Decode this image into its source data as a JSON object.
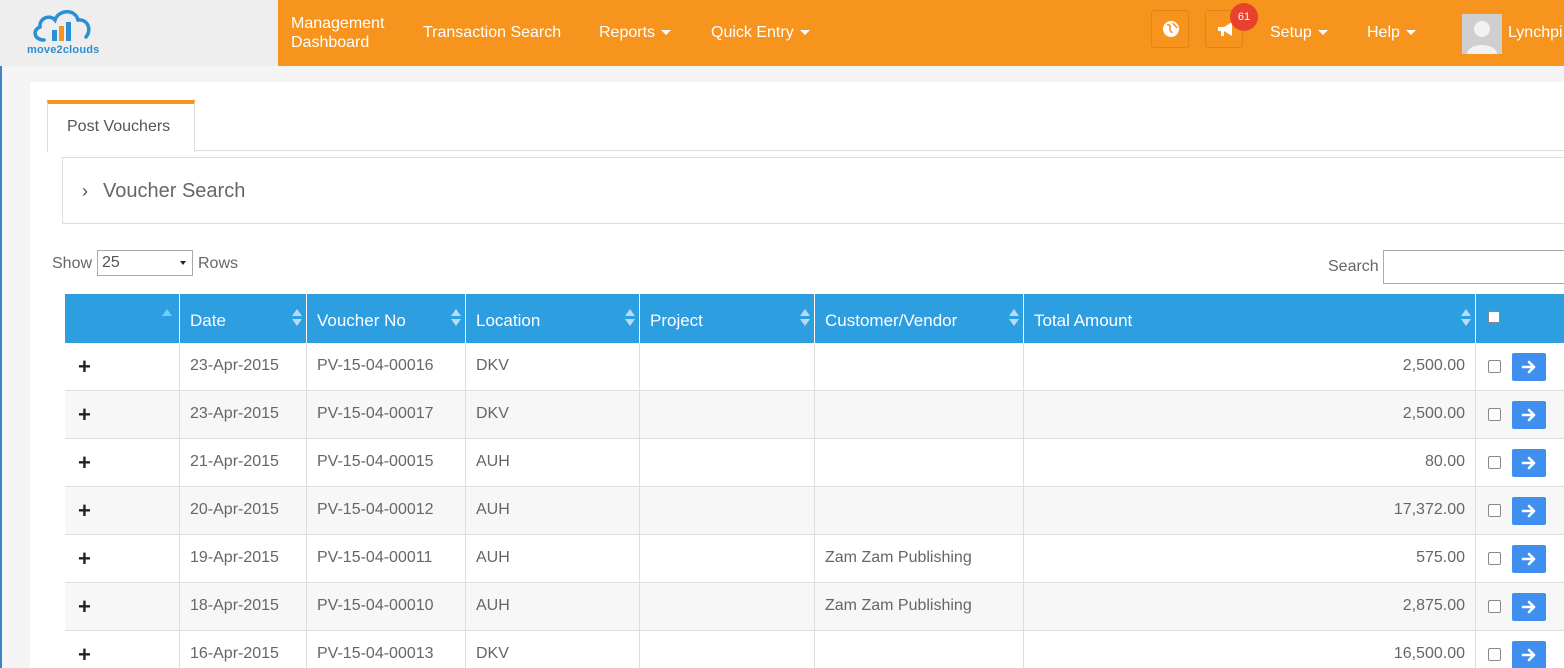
{
  "header": {
    "logo_text": "move2clouds",
    "nav": {
      "management_line1": "Management",
      "management_line2": "Dashboard",
      "transaction_search": "Transaction Search",
      "reports": "Reports",
      "quick_entry": "Quick Entry",
      "setup": "Setup",
      "help": "Help"
    },
    "notification_count": "61",
    "user_name": "Lynchpi",
    "accent_color": "#f7941d"
  },
  "tab": {
    "label": "Post Vouchers"
  },
  "voucher_search": {
    "title": "Voucher Search"
  },
  "table_controls": {
    "show_label": "Show",
    "rows_value": "25",
    "rows_label": "Rows",
    "search_label": "Search",
    "search_value": ""
  },
  "table": {
    "header_color": "#2d9ee0",
    "columns": [
      "Date",
      "Voucher No",
      "Location",
      "Project",
      "Customer/Vendor",
      "Total Amount"
    ],
    "rows": [
      {
        "date": "23-Apr-2015",
        "voucher_no": "PV-15-04-00016",
        "location": "DKV",
        "project": "",
        "customer_vendor": "",
        "total_amount": "2,500.00"
      },
      {
        "date": "23-Apr-2015",
        "voucher_no": "PV-15-04-00017",
        "location": "DKV",
        "project": "",
        "customer_vendor": "",
        "total_amount": "2,500.00"
      },
      {
        "date": "21-Apr-2015",
        "voucher_no": "PV-15-04-00015",
        "location": "AUH",
        "project": "",
        "customer_vendor": "",
        "total_amount": "80.00"
      },
      {
        "date": "20-Apr-2015",
        "voucher_no": "PV-15-04-00012",
        "location": "AUH",
        "project": "",
        "customer_vendor": "",
        "total_amount": "17,372.00"
      },
      {
        "date": "19-Apr-2015",
        "voucher_no": "PV-15-04-00011",
        "location": "AUH",
        "project": "",
        "customer_vendor": "Zam Zam Publishing",
        "total_amount": "575.00"
      },
      {
        "date": "18-Apr-2015",
        "voucher_no": "PV-15-04-00010",
        "location": "AUH",
        "project": "",
        "customer_vendor": "Zam Zam Publishing",
        "total_amount": "2,875.00"
      },
      {
        "date": "16-Apr-2015",
        "voucher_no": "PV-15-04-00013",
        "location": "DKV",
        "project": "",
        "customer_vendor": "",
        "total_amount": "16,500.00"
      }
    ],
    "expand_symbol": "+"
  }
}
